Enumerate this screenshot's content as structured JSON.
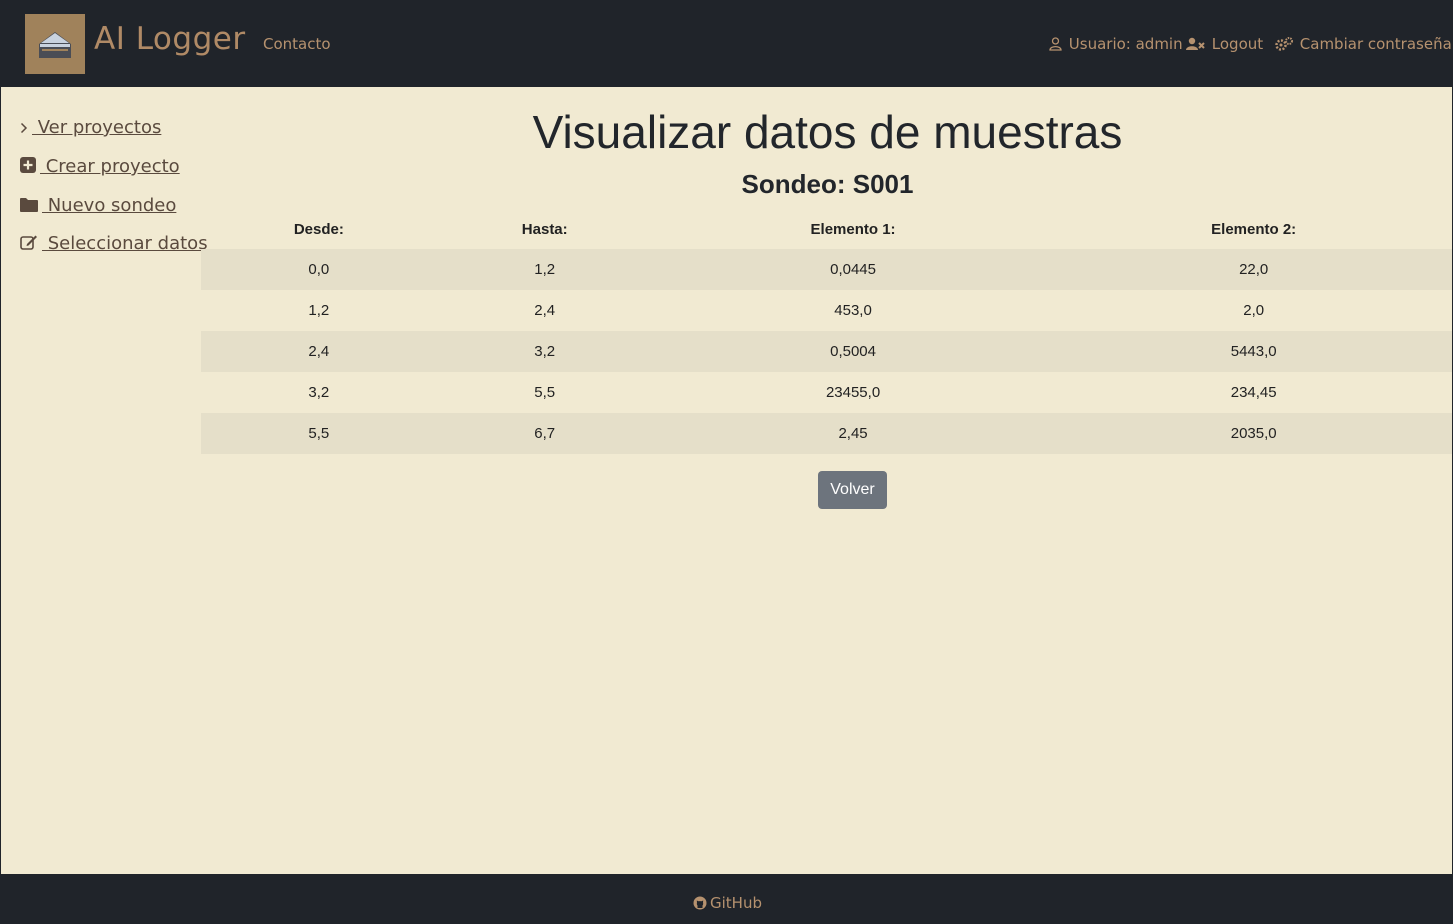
{
  "navbar": {
    "brand": "AI Logger",
    "contact": "Contacto",
    "user": "Usuario: admin",
    "logout": "Logout",
    "change_password": "Cambiar contraseña"
  },
  "sidebar": {
    "items": [
      {
        "label": " Ver proyectos",
        "icon": "chevron-right-icon"
      },
      {
        "label": " Crear proyecto",
        "icon": "plus-square-icon"
      },
      {
        "label": " Nuevo sondeo",
        "icon": "folder-icon"
      },
      {
        "label": " Seleccionar datos",
        "icon": "edit-icon"
      }
    ]
  },
  "main": {
    "title": "Visualizar datos de muestras",
    "subtitle": "Sondeo: S001",
    "table": {
      "headers": [
        "Desde:",
        "Hasta:",
        "Elemento 1:",
        "Elemento 2:"
      ],
      "rows": [
        [
          "0,0",
          "1,2",
          "0,0445",
          "22,0"
        ],
        [
          "1,2",
          "2,4",
          "453,0",
          "2,0"
        ],
        [
          "2,4",
          "3,2",
          "0,5004",
          "5443,0"
        ],
        [
          "3,2",
          "5,5",
          "23455,0",
          "234,45"
        ],
        [
          "5,5",
          "6,7",
          "2,45",
          "2035,0"
        ]
      ]
    },
    "back_button": "Volver"
  },
  "footer": {
    "github": "GitHub"
  },
  "colors": {
    "navbar_bg": "#20242a",
    "page_bg": "#f1ead2",
    "accent": "#b6926f",
    "button_bg": "#6d747d"
  }
}
